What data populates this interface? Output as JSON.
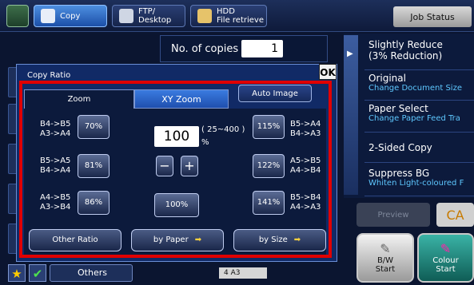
{
  "tabs": {
    "copy": "Copy",
    "ftp_desktop_line1": "FTP/",
    "ftp_desktop_line2": "Desktop",
    "hdd_line1": "HDD",
    "hdd_line2": "File retrieve"
  },
  "job_status": "Job Status",
  "copies": {
    "label": "No. of copies",
    "value": "1"
  },
  "dialog": {
    "title": "Copy Ratio",
    "ok": "OK",
    "tab_zoom": "Zoom",
    "tab_xy_zoom": "XY Zoom",
    "auto_image": "Auto Image",
    "ratio_value": "100",
    "ratio_range": "( 25~400 )",
    "ratio_unit": "%",
    "minus": "−",
    "plus": "+",
    "center_preset": "100%",
    "left_presets": [
      {
        "l1": "B4->B5",
        "l2": "A3->A4",
        "btn": "70%"
      },
      {
        "l1": "B5->A5",
        "l2": "B4->A4",
        "btn": "81%"
      },
      {
        "l1": "A4->B5",
        "l2": "A3->B4",
        "btn": "86%"
      }
    ],
    "right_presets": [
      {
        "l1": "B5->A4",
        "l2": "B4->A3",
        "btn": "115%"
      },
      {
        "l1": "A5->B5",
        "l2": "A4->B4",
        "btn": "122%"
      },
      {
        "l1": "B5->B4",
        "l2": "A4->A3",
        "btn": "141%"
      }
    ],
    "other_ratio": "Other Ratio",
    "by_paper": "by Paper",
    "by_size": "by Size"
  },
  "right_panel": [
    {
      "title": "Slightly Reduce",
      "title2": "(3% Reduction)",
      "sub": ""
    },
    {
      "title": "Original",
      "title2": "",
      "sub": "Change Document Size"
    },
    {
      "title": "Paper Select",
      "title2": "",
      "sub": "Change Paper Feed Tra"
    },
    {
      "title": "2-Sided Copy",
      "title2": "",
      "sub": ""
    },
    {
      "title": "Suppress BG",
      "title2": "",
      "sub": "Whiten Light-coloured F"
    }
  ],
  "preview": "Preview",
  "ca": "CA",
  "bw_start": {
    "l1": "B/W",
    "l2": "Start"
  },
  "colour_start": {
    "l1": "Colour",
    "l2": "Start"
  },
  "others": "Others",
  "paper_indicator": "4  A3",
  "colors": {
    "accent": "#2f6fd6",
    "highlight_frame": "#e00000",
    "info_text": "#5ec8ff"
  }
}
